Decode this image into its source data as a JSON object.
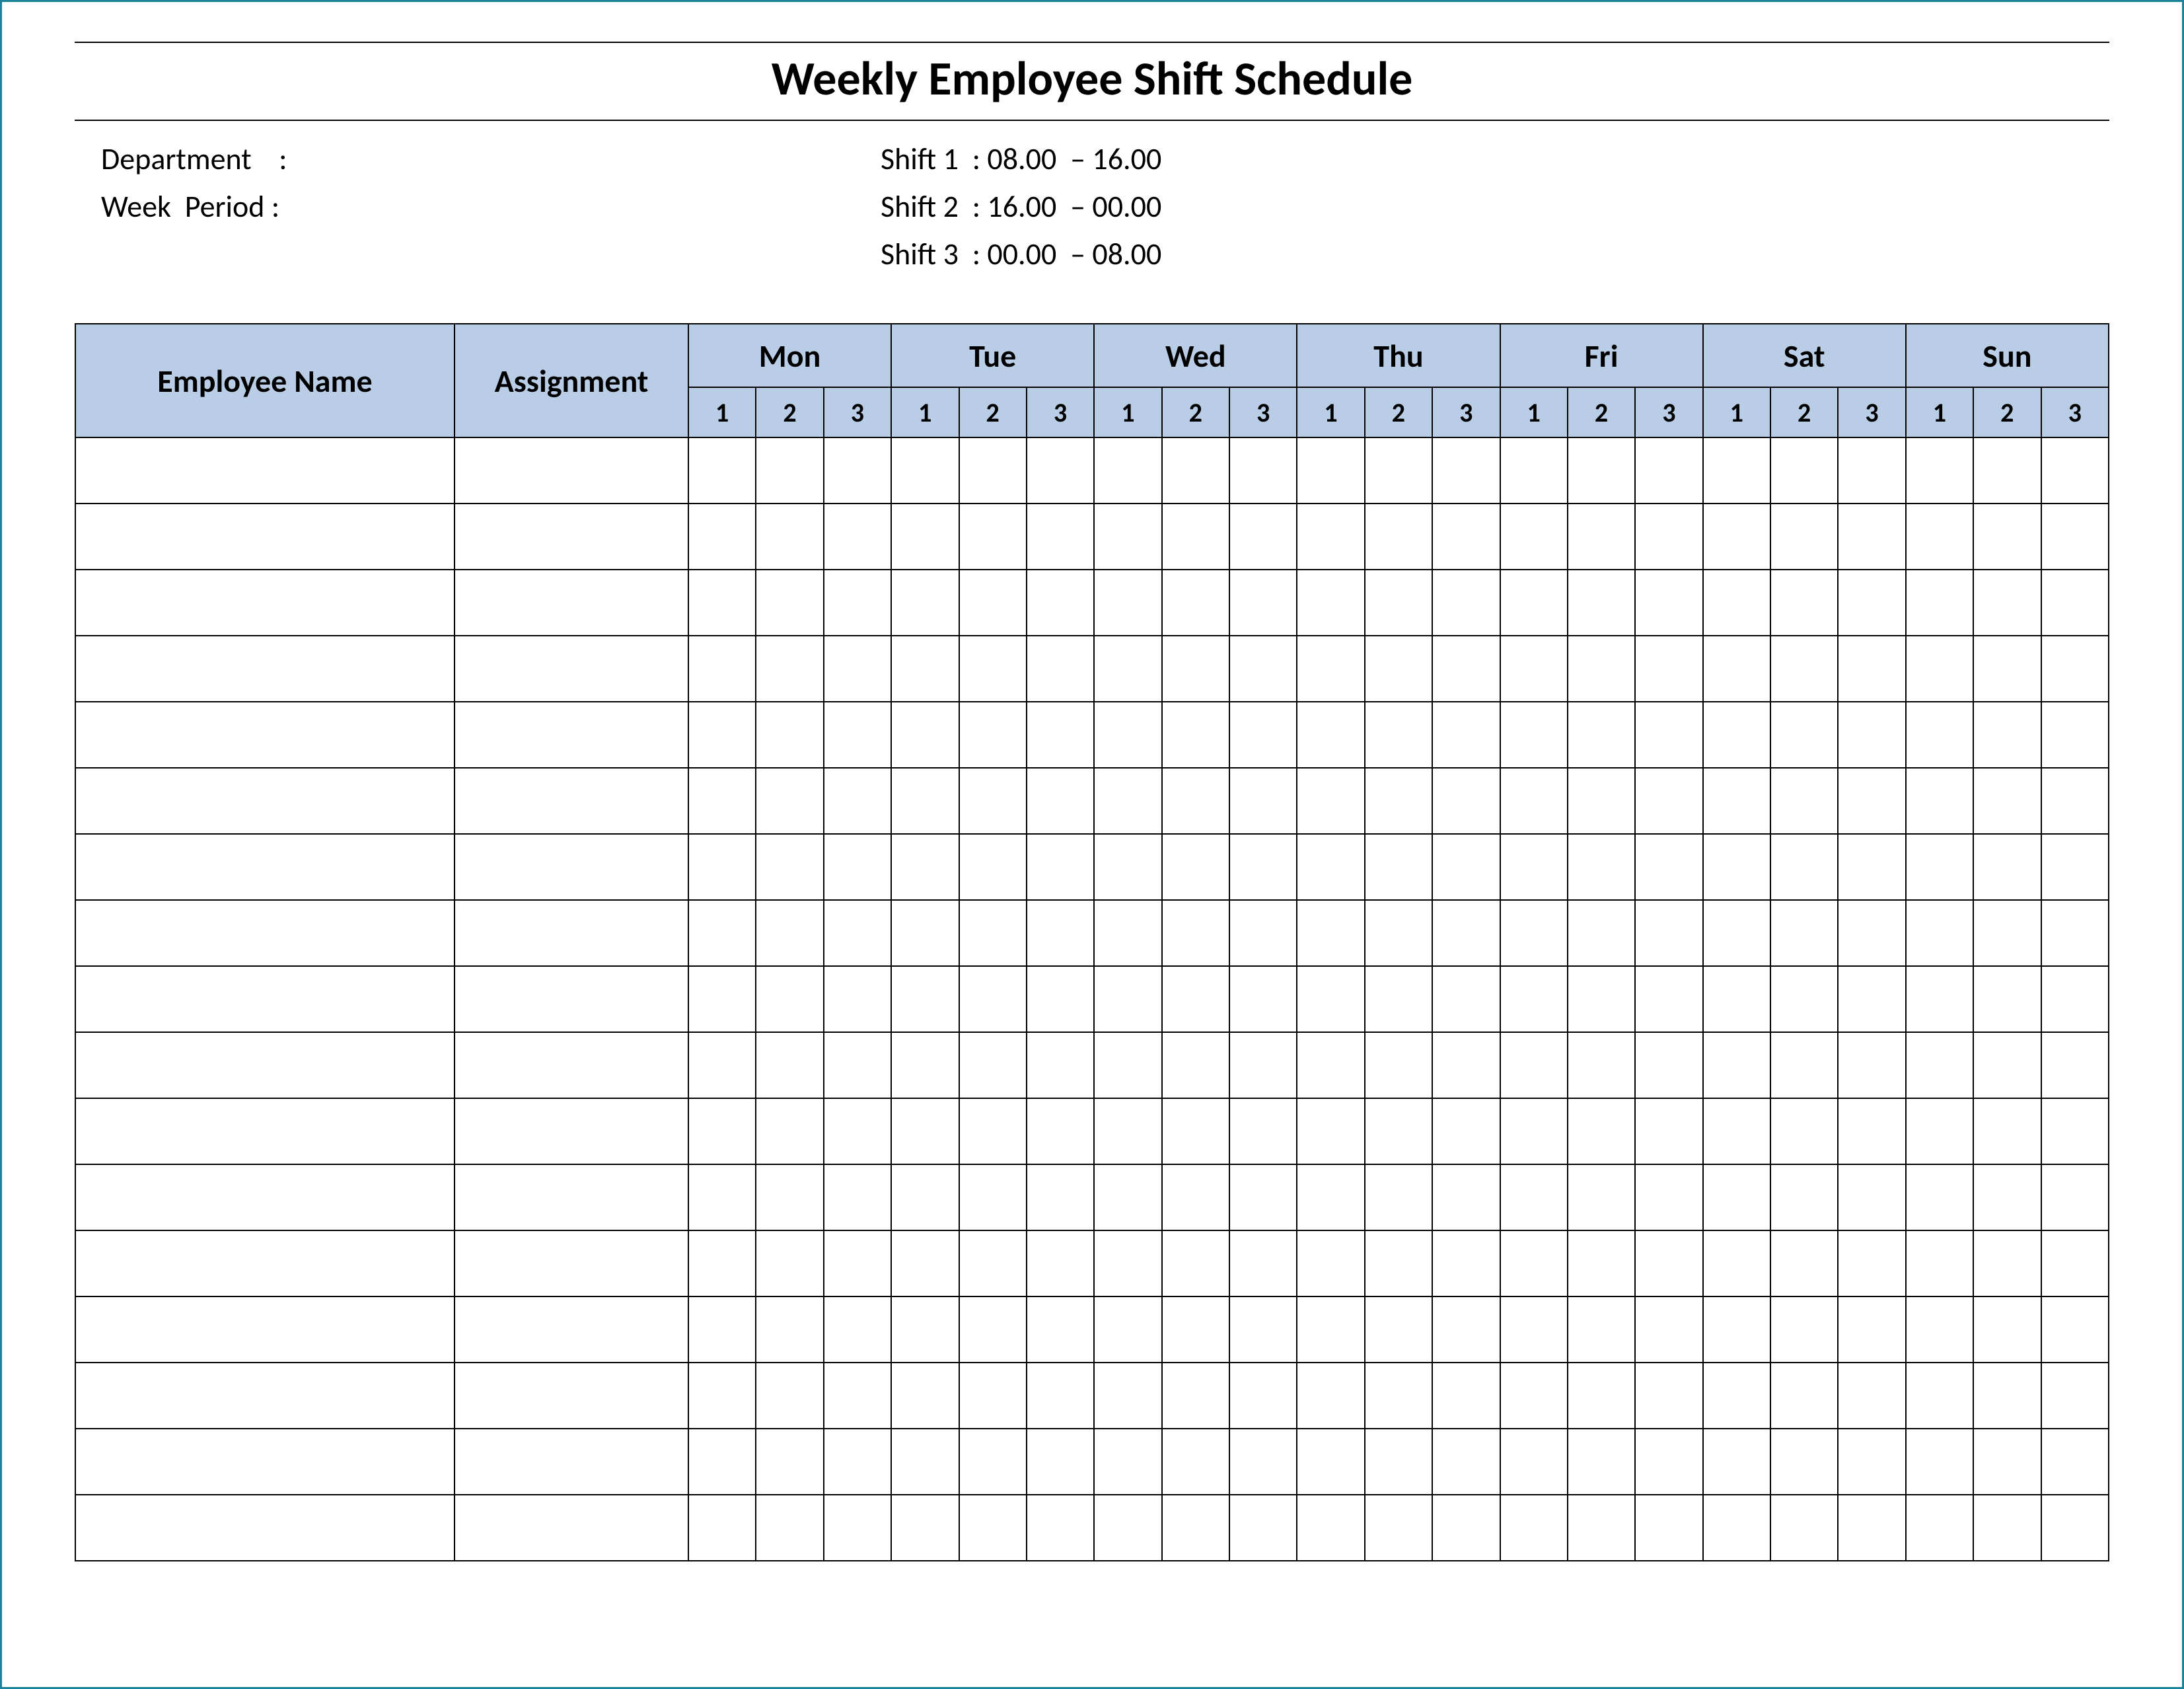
{
  "title": "Weekly Employee Shift Schedule",
  "meta": {
    "department_label": "Department    :",
    "week_period_label": "Week  Period :",
    "shift1": "Shift 1  : 08.00  – 16.00",
    "shift2": "Shift 2  : 16.00  – 00.00",
    "shift3": "Shift 3  : 00.00  – 08.00"
  },
  "columns": {
    "employee_name": "Employee Name",
    "assignment": "Assignment",
    "days": [
      "Mon",
      "Tue",
      "Wed",
      "Thu",
      "Fri",
      "Sat",
      "Sun"
    ],
    "shifts": [
      "1",
      "2",
      "3"
    ]
  },
  "rows": [
    {
      "name": "",
      "assignment": "",
      "cells": [
        "",
        "",
        "",
        "",
        "",
        "",
        "",
        "",
        "",
        "",
        "",
        "",
        "",
        "",
        "",
        "",
        "",
        "",
        "",
        "",
        ""
      ]
    },
    {
      "name": "",
      "assignment": "",
      "cells": [
        "",
        "",
        "",
        "",
        "",
        "",
        "",
        "",
        "",
        "",
        "",
        "",
        "",
        "",
        "",
        "",
        "",
        "",
        "",
        "",
        ""
      ]
    },
    {
      "name": "",
      "assignment": "",
      "cells": [
        "",
        "",
        "",
        "",
        "",
        "",
        "",
        "",
        "",
        "",
        "",
        "",
        "",
        "",
        "",
        "",
        "",
        "",
        "",
        "",
        ""
      ]
    },
    {
      "name": "",
      "assignment": "",
      "cells": [
        "",
        "",
        "",
        "",
        "",
        "",
        "",
        "",
        "",
        "",
        "",
        "",
        "",
        "",
        "",
        "",
        "",
        "",
        "",
        "",
        ""
      ]
    },
    {
      "name": "",
      "assignment": "",
      "cells": [
        "",
        "",
        "",
        "",
        "",
        "",
        "",
        "",
        "",
        "",
        "",
        "",
        "",
        "",
        "",
        "",
        "",
        "",
        "",
        "",
        ""
      ]
    },
    {
      "name": "",
      "assignment": "",
      "cells": [
        "",
        "",
        "",
        "",
        "",
        "",
        "",
        "",
        "",
        "",
        "",
        "",
        "",
        "",
        "",
        "",
        "",
        "",
        "",
        "",
        ""
      ]
    },
    {
      "name": "",
      "assignment": "",
      "cells": [
        "",
        "",
        "",
        "",
        "",
        "",
        "",
        "",
        "",
        "",
        "",
        "",
        "",
        "",
        "",
        "",
        "",
        "",
        "",
        "",
        ""
      ]
    },
    {
      "name": "",
      "assignment": "",
      "cells": [
        "",
        "",
        "",
        "",
        "",
        "",
        "",
        "",
        "",
        "",
        "",
        "",
        "",
        "",
        "",
        "",
        "",
        "",
        "",
        "",
        ""
      ]
    },
    {
      "name": "",
      "assignment": "",
      "cells": [
        "",
        "",
        "",
        "",
        "",
        "",
        "",
        "",
        "",
        "",
        "",
        "",
        "",
        "",
        "",
        "",
        "",
        "",
        "",
        "",
        ""
      ]
    },
    {
      "name": "",
      "assignment": "",
      "cells": [
        "",
        "",
        "",
        "",
        "",
        "",
        "",
        "",
        "",
        "",
        "",
        "",
        "",
        "",
        "",
        "",
        "",
        "",
        "",
        "",
        ""
      ]
    },
    {
      "name": "",
      "assignment": "",
      "cells": [
        "",
        "",
        "",
        "",
        "",
        "",
        "",
        "",
        "",
        "",
        "",
        "",
        "",
        "",
        "",
        "",
        "",
        "",
        "",
        "",
        ""
      ]
    },
    {
      "name": "",
      "assignment": "",
      "cells": [
        "",
        "",
        "",
        "",
        "",
        "",
        "",
        "",
        "",
        "",
        "",
        "",
        "",
        "",
        "",
        "",
        "",
        "",
        "",
        "",
        ""
      ]
    },
    {
      "name": "",
      "assignment": "",
      "cells": [
        "",
        "",
        "",
        "",
        "",
        "",
        "",
        "",
        "",
        "",
        "",
        "",
        "",
        "",
        "",
        "",
        "",
        "",
        "",
        "",
        ""
      ]
    },
    {
      "name": "",
      "assignment": "",
      "cells": [
        "",
        "",
        "",
        "",
        "",
        "",
        "",
        "",
        "",
        "",
        "",
        "",
        "",
        "",
        "",
        "",
        "",
        "",
        "",
        "",
        ""
      ]
    },
    {
      "name": "",
      "assignment": "",
      "cells": [
        "",
        "",
        "",
        "",
        "",
        "",
        "",
        "",
        "",
        "",
        "",
        "",
        "",
        "",
        "",
        "",
        "",
        "",
        "",
        "",
        ""
      ]
    },
    {
      "name": "",
      "assignment": "",
      "cells": [
        "",
        "",
        "",
        "",
        "",
        "",
        "",
        "",
        "",
        "",
        "",
        "",
        "",
        "",
        "",
        "",
        "",
        "",
        "",
        "",
        ""
      ]
    },
    {
      "name": "",
      "assignment": "",
      "cells": [
        "",
        "",
        "",
        "",
        "",
        "",
        "",
        "",
        "",
        "",
        "",
        "",
        "",
        "",
        "",
        "",
        "",
        "",
        "",
        "",
        ""
      ]
    }
  ]
}
